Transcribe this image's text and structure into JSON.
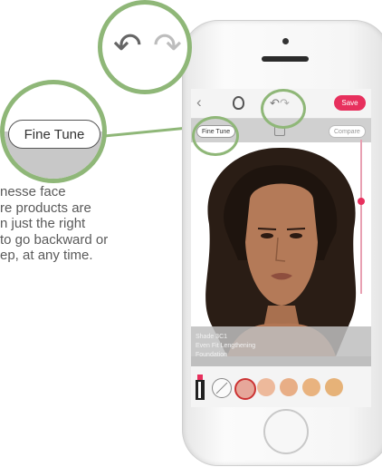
{
  "caption": {
    "lines": [
      "nesse face",
      "re products are",
      "n just the right",
      "to go backward or",
      "ep, at any time."
    ]
  },
  "zoom_undo": {
    "undo_icon": "undo-arrow-icon",
    "redo_icon": "redo-arrow-icon"
  },
  "zoom_finetune": {
    "label": "Fine Tune"
  },
  "app": {
    "toolbar": {
      "back_icon": "chevron-left-icon",
      "face_icon": "face-icon",
      "undo_icon": "undo-arrow-icon",
      "redo_icon": "redo-arrow-icon",
      "save_label": "Save"
    },
    "subbar": {
      "fine_tune_label": "Fine Tune",
      "camera_icon": "camera-icon",
      "compare_label": "Compare"
    },
    "product_info": {
      "line1": "Shade 3C1",
      "line2": "Even Fit Lengthening",
      "line3": "Foundation"
    },
    "swatches": [
      "#e6a79a",
      "#edb99b",
      "#e8ae86",
      "#e9b37f",
      "#e6b278"
    ],
    "accent": "#e7305d"
  }
}
